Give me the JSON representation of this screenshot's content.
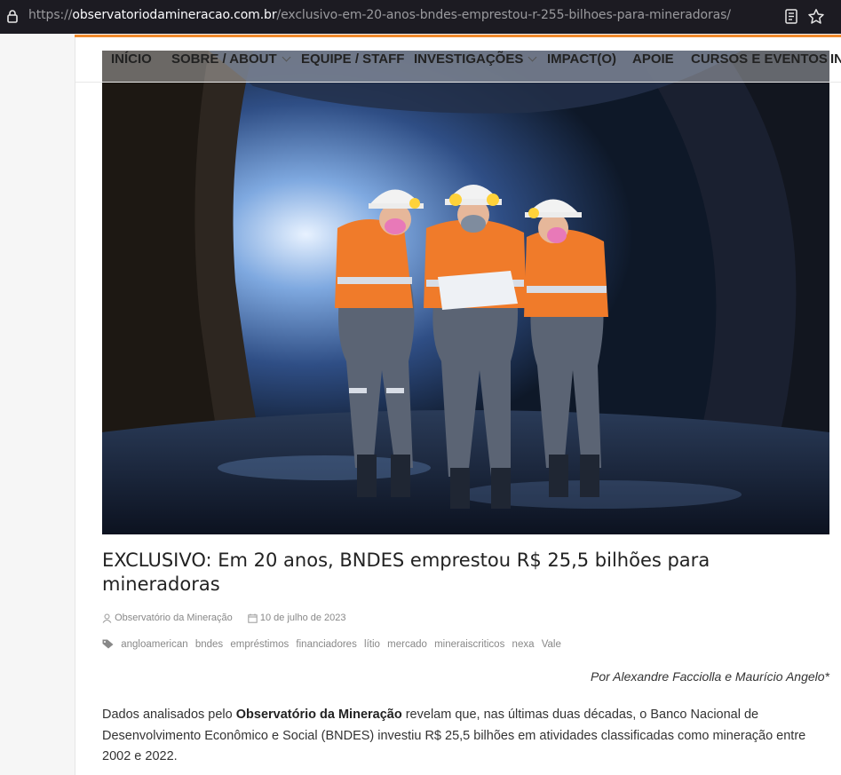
{
  "browser": {
    "url_scheme": "https://",
    "url_host": "observatoriodamineracao.com.br",
    "url_path": "/exclusivo-em-20-anos-bndes-emprestou-r-255-bilhoes-para-mineradoras/"
  },
  "nav": {
    "items": [
      "INÍCIO",
      "SOBRE / ABOUT",
      "EQUIPE / STAFF",
      "INVESTIGAÇÕES",
      "IMPACT(O)",
      "APOIE",
      "CURSOS E EVENTOS",
      "IN"
    ]
  },
  "article": {
    "title": "EXCLUSIVO: Em 20 anos, BNDES emprestou R$ 25,5 bilhões para mineradoras",
    "author": "Observatório da Mineração",
    "date": "10 de julho de 2023",
    "tags": [
      "angloamerican",
      "bndes",
      "empréstimos",
      "financiadores",
      "lítio",
      "mercado",
      "mineraiscriticos",
      "nexa",
      "Vale"
    ],
    "byline": "Por Alexandre Facciolla e Maurício Angelo*",
    "body_pre": "Dados analisados pelo ",
    "body_bold": "Observatório da Mineração",
    "body_post": " revelam que, nas últimas duas décadas, o Banco Nacional de Desenvolvimento Econômico e Social (BNDES) investiu R$ 25,5 bilhões em atividades classificadas como mineração entre 2002 e 2022."
  },
  "colors": {
    "accent": "#f08a2c",
    "helmet": "#f2f2f2",
    "vest": "#f07b2a"
  },
  "icons": {
    "lock": "lock-icon",
    "reader": "reader-view-icon",
    "star": "bookmark-star-icon",
    "author": "user-icon",
    "date": "calendar-icon",
    "tags": "tag-icon"
  }
}
